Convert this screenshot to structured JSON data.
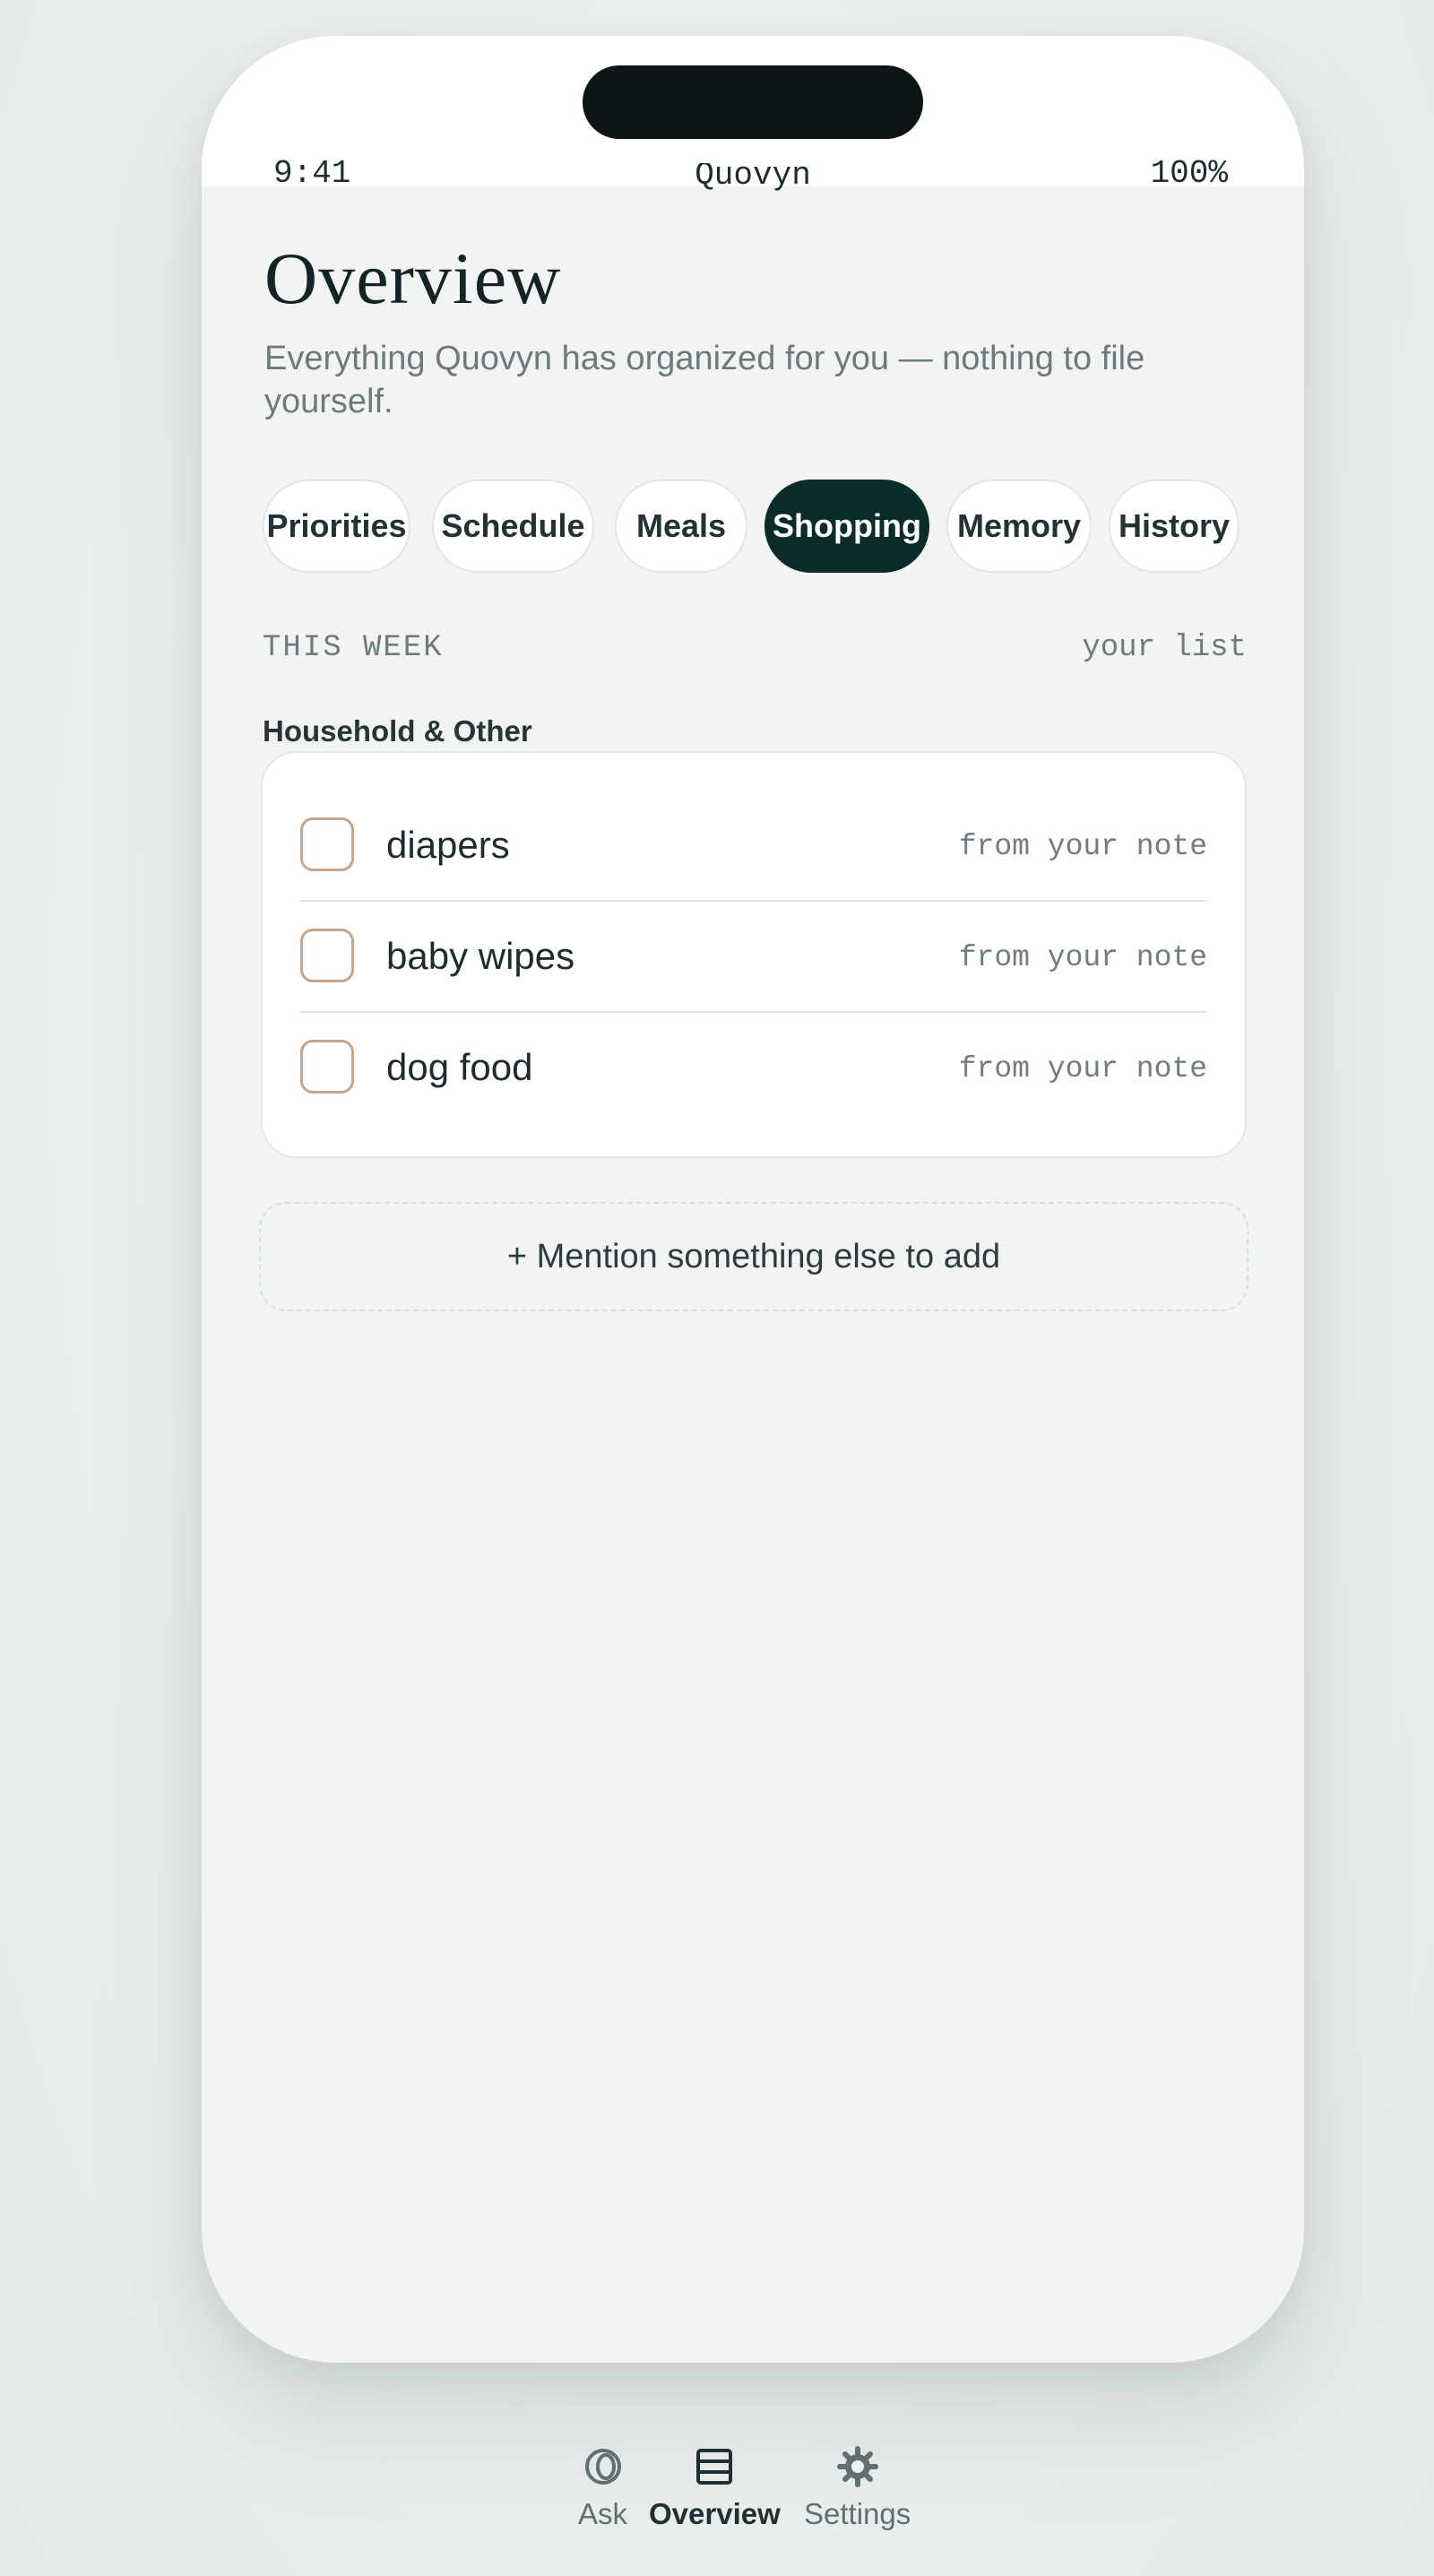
{
  "status_bar": {
    "time": "9:41",
    "app_name": "Quovyn",
    "battery": "100%"
  },
  "page": {
    "title": "Overview",
    "subtitle": "Everything Quovyn has organized for you — nothing to file yourself."
  },
  "tabs": [
    {
      "label": "Priorities",
      "active": false
    },
    {
      "label": "Schedule",
      "active": false
    },
    {
      "label": "Meals",
      "active": false
    },
    {
      "label": "Shopping",
      "active": true
    },
    {
      "label": "Memory",
      "active": false
    },
    {
      "label": "History",
      "active": false
    }
  ],
  "section": {
    "label": "THIS WEEK",
    "note": "your list"
  },
  "group": {
    "label": "Household & Other",
    "items": [
      {
        "name": "diapers",
        "source": "from your note",
        "checked": false
      },
      {
        "name": "baby wipes",
        "source": "from your note",
        "checked": false
      },
      {
        "name": "dog food",
        "source": "from your note",
        "checked": false
      }
    ]
  },
  "add_button": {
    "label": "+ Mention something else to add"
  },
  "bottom_nav": [
    {
      "label": "Ask",
      "icon": "ask-icon",
      "active": false
    },
    {
      "label": "Overview",
      "icon": "overview-icon",
      "active": true
    },
    {
      "label": "Settings",
      "icon": "gear-icon",
      "active": false
    }
  ],
  "colors": {
    "accent": "#0c2b2b",
    "checkbox_border": "#c8a48a",
    "background": "#f2f4f3"
  }
}
